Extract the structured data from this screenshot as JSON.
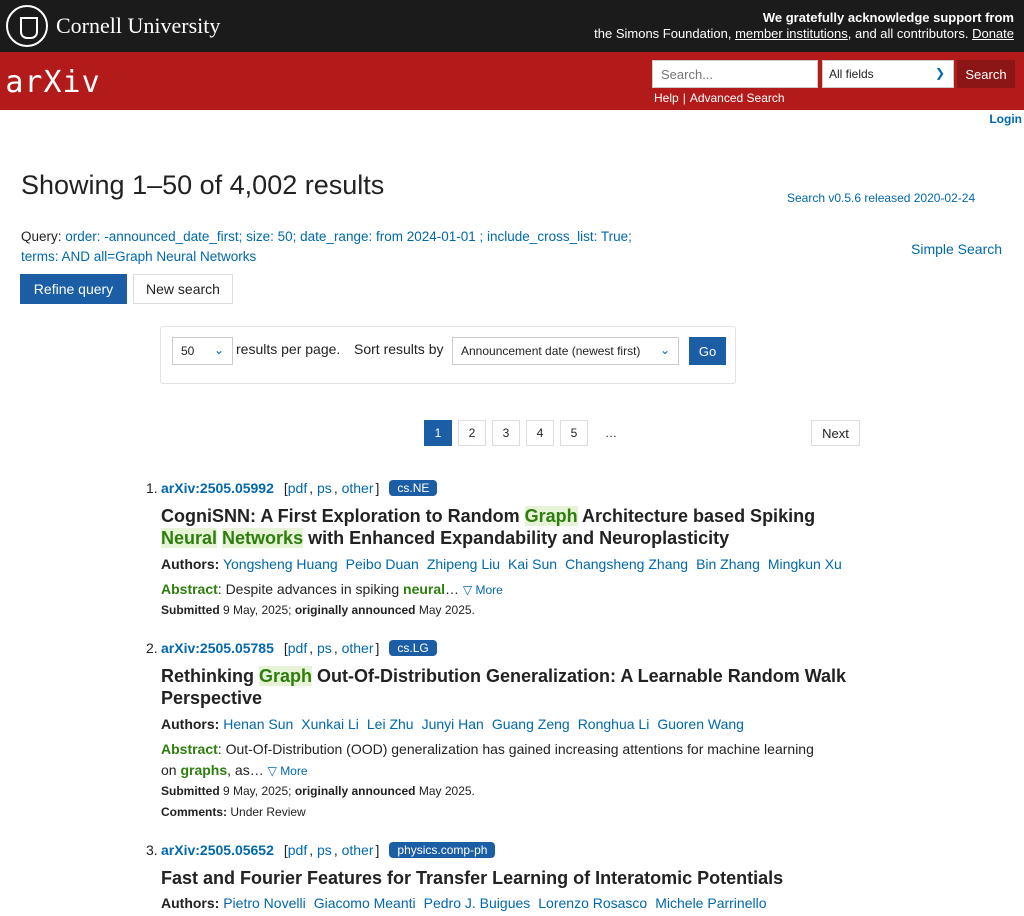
{
  "topbar": {
    "institution": "Cornell University",
    "ack_line1": "We gratefully acknowledge support from",
    "ack_line2_pre": "the Simons Foundation, ",
    "member_link": "member institutions",
    "ack_line2_post": ", and all contributors. ",
    "donate": "Donate"
  },
  "header": {
    "logo": "arXiv",
    "search_placeholder": "Search...",
    "field_select": "All fields",
    "search_button": "Search",
    "help": "Help",
    "advanced": "Advanced Search",
    "login": "Login"
  },
  "main": {
    "title": "Showing 1–50 of 4,002 results",
    "version": "Search v0.5.6 released 2020-02-24",
    "query_label": "Query: ",
    "query_text": "order: -announced_date_first; size: 50; date_range: from 2024-01-01 ; include_cross_list: True; terms: AND all=Graph Neural Networks",
    "simple_search": "Simple Search",
    "refine_button": "Refine query",
    "new_search_button": "New search",
    "page_size": "50",
    "rpp_label": "results per page.",
    "sort_label": "Sort results by",
    "sort_value": "Announcement date (newest first)",
    "go_button": "Go",
    "pages": [
      "1",
      "2",
      "3",
      "4",
      "5",
      "…"
    ],
    "next": "Next"
  },
  "results": [
    {
      "num": "1.",
      "id": "arXiv:2505.05992",
      "links": [
        "pdf",
        "ps",
        "other"
      ],
      "tag": "cs.NE",
      "title_parts": [
        {
          "t": "CogniSNN: A First Exploration to Random ",
          "hl": false
        },
        {
          "t": "Graph",
          "hl": true
        },
        {
          "t": " Architecture based Spiking ",
          "hl": false
        },
        {
          "t": "Neural",
          "hl": true
        },
        {
          "t": " ",
          "hl": false
        },
        {
          "t": "Networks",
          "hl": true
        },
        {
          "t": " with Enhanced Expandability and Neuroplasticity",
          "hl": false
        }
      ],
      "authors_label": "Authors:",
      "authors": [
        "Yongsheng Huang",
        "Peibo Duan",
        "Zhipeng Liu",
        "Kai Sun",
        "Changsheng Zhang",
        "Bin Zhang",
        "Mingkun Xu"
      ],
      "abstract_label": "Abstract",
      "abstract_pre": ": Despite advances in spiking ",
      "abstract_hl": "neural",
      "abstract_post": "…",
      "abstract_line2_pre": "",
      "abstract_line2_hl": "",
      "abstract_line2_post": "",
      "more": "▽ More",
      "submitted_label": "Submitted",
      "submitted_date": " 9 May, 2025; ",
      "announced_label": "originally announced",
      "announced_date": " May 2025.",
      "comments_label": "",
      "comments": ""
    },
    {
      "num": "2.",
      "id": "arXiv:2505.05785",
      "links": [
        "pdf",
        "ps",
        "other"
      ],
      "tag": "cs.LG",
      "title_parts": [
        {
          "t": "Rethinking ",
          "hl": false
        },
        {
          "t": "Graph",
          "hl": true
        },
        {
          "t": " Out-Of-Distribution Generalization: A Learnable Random Walk Perspective",
          "hl": false
        }
      ],
      "authors_label": "Authors:",
      "authors": [
        "Henan Sun",
        "Xunkai Li",
        "Lei Zhu",
        "Junyi Han",
        "Guang Zeng",
        "Ronghua Li",
        "Guoren Wang"
      ],
      "abstract_label": "Abstract",
      "abstract_pre": ": Out-Of-Distribution (OOD) generalization has gained increasing attentions for machine learning",
      "abstract_hl": "",
      "abstract_post": "",
      "abstract_line2_pre": "on ",
      "abstract_line2_hl": "graphs",
      "abstract_line2_post": ", as…",
      "more": "▽ More",
      "submitted_label": "Submitted",
      "submitted_date": " 9 May, 2025; ",
      "announced_label": "originally announced",
      "announced_date": " May 2025.",
      "comments_label": "Comments:",
      "comments": " Under Review"
    },
    {
      "num": "3.",
      "id": "arXiv:2505.05652",
      "links": [
        "pdf",
        "ps",
        "other"
      ],
      "tag": "physics.comp-ph",
      "title_parts": [
        {
          "t": "Fast and Fourier Features for Transfer Learning of Interatomic Potentials",
          "hl": false
        }
      ],
      "authors_label": "Authors:",
      "authors": [
        "Pietro Novelli",
        "Giacomo Meanti",
        "Pedro J. Buigues",
        "Lorenzo Rosasco",
        "Michele Parrinello"
      ]
    }
  ]
}
